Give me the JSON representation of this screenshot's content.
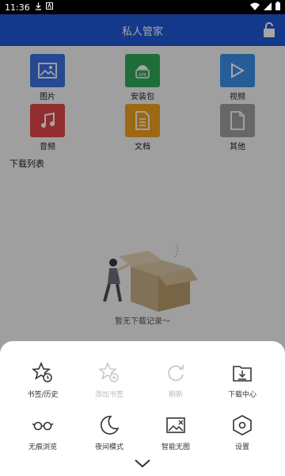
{
  "status_bar": {
    "time": "11:36",
    "icons": [
      "download-icon",
      "notification-a-icon",
      "wifi-icon",
      "signal-icon",
      "battery-icon"
    ]
  },
  "app_bar": {
    "title": "私人管家",
    "lock_icon": "lock-icon",
    "color": "#1f58d4"
  },
  "categories": [
    {
      "label": "图片",
      "icon": "image-icon",
      "color": "#3d6fe0"
    },
    {
      "label": "安装包",
      "icon": "apk-icon",
      "color": "#2eaa5a"
    },
    {
      "label": "视频",
      "icon": "video-icon",
      "color": "#3b8fe6"
    },
    {
      "label": "音频",
      "icon": "music-icon",
      "color": "#e04545"
    },
    {
      "label": "文档",
      "icon": "document-icon",
      "color": "#f0a020"
    },
    {
      "label": "其他",
      "icon": "file-icon",
      "color": "#9e9e9e"
    }
  ],
  "download_list": {
    "title": "下载列表",
    "empty_text": "暂无下载记录～"
  },
  "menu": [
    {
      "label": "书签/历史",
      "icon": "bookmark-history-icon",
      "enabled": true
    },
    {
      "label": "添加书签",
      "icon": "add-bookmark-icon",
      "enabled": false
    },
    {
      "label": "刷新",
      "icon": "refresh-icon",
      "enabled": false
    },
    {
      "label": "下载中心",
      "icon": "download-center-icon",
      "enabled": true
    },
    {
      "label": "无痕浏览",
      "icon": "incognito-icon",
      "enabled": true
    },
    {
      "label": "夜间模式",
      "icon": "night-mode-icon",
      "enabled": true
    },
    {
      "label": "智能无图",
      "icon": "no-image-icon",
      "enabled": true
    },
    {
      "label": "设置",
      "icon": "settings-icon",
      "enabled": true
    }
  ],
  "collapse_icon": "chevron-down-icon"
}
